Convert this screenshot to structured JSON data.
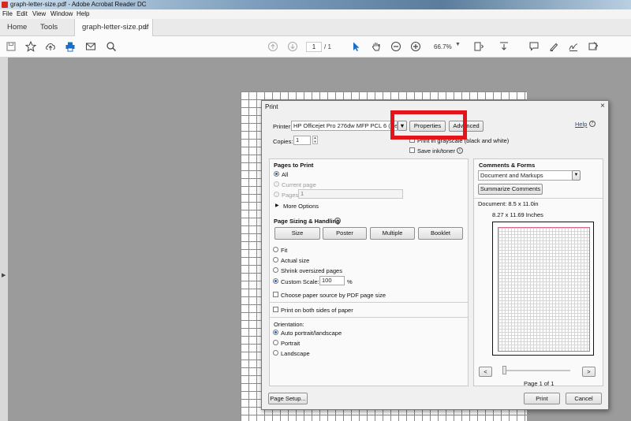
{
  "window": {
    "title": "graph-letter-size.pdf - Adobe Acrobat Reader DC"
  },
  "menu": {
    "items": [
      "File",
      "Edit",
      "View",
      "Window",
      "Help"
    ]
  },
  "tabs": {
    "home": "Home",
    "tools": "Tools",
    "document": "graph-letter-size.pdf",
    "close": "×"
  },
  "toolbar": {
    "icons": [
      "save-icon",
      "bookmark-star-icon",
      "upload-icon",
      "print-icon",
      "email-icon",
      "search-icon",
      "prev-page-icon",
      "next-page-icon",
      "select-arrow-icon",
      "hand-icon",
      "zoom-out-icon",
      "zoom-in-icon",
      "page-fit-icon",
      "scroll-mode-icon",
      "comment-icon",
      "highlight-pen-icon",
      "sign-icon",
      "more-tools-icon"
    ],
    "page_current": "1",
    "page_total": "/ 1",
    "zoom": "66.7%",
    "accent_color": "#1b6ec2"
  },
  "dialog": {
    "title": "Print",
    "close": "×",
    "help": "Help",
    "printer_label": "Printer:",
    "printer_value": "HP Officejet Pro 276dw MFP PCL 6 (Netw",
    "properties": "Properties",
    "advanced": "Advanced",
    "copies_label": "Copies:",
    "copies_value": "1",
    "grayscale_option": "Print in grayscale (black and white)",
    "save_ink": "Save ink/toner",
    "pages_to_print": {
      "heading": "Pages to Print",
      "all": "All",
      "current": "Current page",
      "pages": "Pages",
      "pages_value": "1",
      "more": "More Options"
    },
    "sizing": {
      "heading": "Page Sizing & Handling",
      "buttons": [
        "Size",
        "Poster",
        "Multiple",
        "Booklet"
      ],
      "fit": "Fit",
      "actual": "Actual size",
      "shrink": "Shrink oversized pages",
      "custom": "Custom Scale:",
      "custom_value": "100",
      "percent": "%",
      "paper_source": "Choose paper source by PDF page size"
    },
    "both_sides": "Print on both sides of paper",
    "orientation": {
      "heading": "Orientation:",
      "auto": "Auto portrait/landscape",
      "portrait": "Portrait",
      "landscape": "Landscape"
    },
    "comments": {
      "heading": "Comments & Forms",
      "value": "Document and Markups",
      "summarize": "Summarize Comments"
    },
    "preview": {
      "document_size": "Document: 8.5 x 11.0in",
      "paper_size": "8.27 x 11.69 Inches",
      "prev": "<",
      "next": ">",
      "page_label": "Page 1 of 1"
    },
    "page_setup": "Page Setup...",
    "print": "Print",
    "cancel": "Cancel",
    "highlight_color": "#e4141a"
  }
}
